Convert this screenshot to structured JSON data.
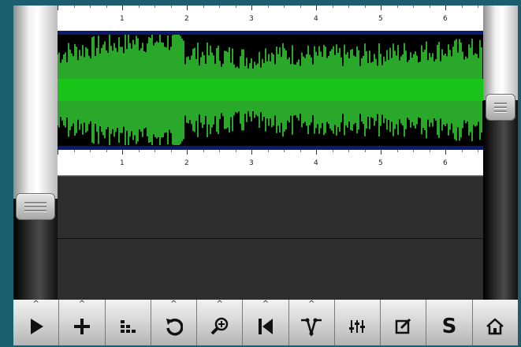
{
  "ruler": {
    "markers": [
      "1",
      "2",
      "3",
      "4",
      "5",
      "6"
    ]
  },
  "waveform": {
    "color_loud": "#2aa82a",
    "color_core": "#19c419",
    "color_bg": "#000000",
    "color_edge": "#0a1a6e"
  },
  "toolbar": {
    "buttons": [
      {
        "name": "play",
        "icon": "play-icon",
        "caret": "^"
      },
      {
        "name": "add",
        "icon": "plus-icon",
        "caret": "^"
      },
      {
        "name": "tracks",
        "icon": "tracks-icon",
        "caret": ""
      },
      {
        "name": "undo",
        "icon": "undo-icon",
        "caret": "^"
      },
      {
        "name": "zoom",
        "icon": "zoom-icon",
        "caret": "^"
      },
      {
        "name": "rewind",
        "icon": "skip-start-icon",
        "caret": "^"
      },
      {
        "name": "envelope",
        "icon": "envelope-icon",
        "caret": "^"
      },
      {
        "name": "mixer",
        "icon": "mixer-icon",
        "caret": ""
      },
      {
        "name": "edit",
        "icon": "edit-icon",
        "caret": ""
      },
      {
        "name": "solo",
        "icon": "solo-icon",
        "caret": "",
        "label": "S"
      },
      {
        "name": "home",
        "icon": "home-icon",
        "caret": ""
      }
    ]
  }
}
